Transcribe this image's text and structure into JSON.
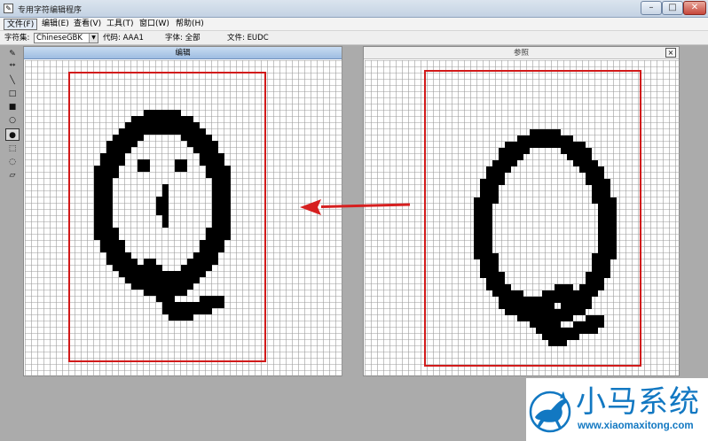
{
  "window": {
    "title": "专用字符编辑程序",
    "min_label": "–",
    "max_label": "□",
    "close_label": "✕"
  },
  "menu": {
    "items": [
      {
        "label": "文件(F)"
      },
      {
        "label": "编辑(E)"
      },
      {
        "label": "查看(V)"
      },
      {
        "label": "工具(T)"
      },
      {
        "label": "窗口(W)"
      },
      {
        "label": "帮助(H)"
      }
    ]
  },
  "infobar": {
    "charset_label": "字符集:",
    "charset_value": "ChineseGBK",
    "code_label": "代码: AAA1",
    "font_label": "字体: 全部",
    "file_label": "文件: EUDC"
  },
  "toolbox": {
    "tools": [
      {
        "icon": "pencil-icon",
        "glyph": "✎"
      },
      {
        "icon": "brush-icon",
        "glyph": "🖌"
      },
      {
        "icon": "line-icon",
        "glyph": "╲"
      },
      {
        "icon": "hollow-rectangle-icon",
        "glyph": "□"
      },
      {
        "icon": "filled-rectangle-icon",
        "glyph": "■"
      },
      {
        "icon": "hollow-ellipse-icon",
        "glyph": "○"
      },
      {
        "icon": "filled-ellipse-icon",
        "glyph": "●"
      },
      {
        "icon": "rectangle-select-icon",
        "glyph": "⬚"
      },
      {
        "icon": "freeform-select-icon",
        "glyph": "◌"
      },
      {
        "icon": "eraser-icon",
        "glyph": "▱"
      }
    ]
  },
  "edit_panel": {
    "title": "编辑"
  },
  "ref_panel": {
    "title": "参照",
    "close_label": "×"
  },
  "watermark": {
    "name": "小马系统",
    "url": "www.xiaomaxitong.com"
  },
  "colors": {
    "frame_red": "#d11a1a",
    "arrow_red": "#d62020",
    "watermark_blue": "#1278c2",
    "pixel_black": "#000000"
  }
}
